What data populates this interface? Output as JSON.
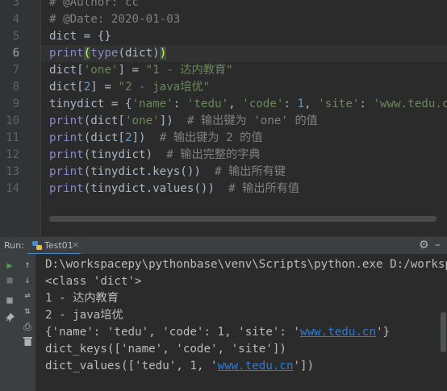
{
  "editor": {
    "line_numbers": [
      "3",
      "4",
      "5",
      "6",
      "7",
      "8",
      "9",
      "10",
      "11",
      "12",
      "13",
      "14"
    ],
    "lines": {
      "l3": "# @Author: cc",
      "l4": "# @Date: 2020-01-03",
      "l5a": "dict = {}",
      "l6_print": "print",
      "l6_open": "(",
      "l6_type": "type",
      "l6_mid": "(dict)",
      "l6_close": ")",
      "l7a": "dict[",
      "l7b": "'one'",
      "l7c": "] = ",
      "l7d": "\"1 - 达内教育\"",
      "l8a": "dict[",
      "l8b": "2",
      "l8c": "] = ",
      "l8d": "\"2 - java培优\"",
      "l9a": "tinydict = {",
      "l9b": "'name'",
      "l9c": ": ",
      "l9d": "'tedu'",
      "l9e": ", ",
      "l9f": "'code'",
      "l9g": ": ",
      "l9h": "1",
      "l9i": ", ",
      "l9j": "'site'",
      "l9k": ": ",
      "l9l": "'www.tedu.cn",
      "l10_print": "print",
      "l10a": "(dict[",
      "l10b": "'one'",
      "l10c": "])  ",
      "l10d": "# 输出键为 'one' 的值",
      "l11_print": "print",
      "l11a": "(dict[",
      "l11b": "2",
      "l11c": "])  ",
      "l11d": "# 输出键为 2 的值",
      "l12_print": "print",
      "l12a": "(tinydict)  ",
      "l12b": "# 输出完整的字典",
      "l13_print": "print",
      "l13a": "(tinydict.keys())  ",
      "l13b": "# 输出所有键",
      "l14_print": "print",
      "l14a": "(tinydict.values())  ",
      "l14b": "# 输出所有值"
    }
  },
  "run_panel": {
    "label": "Run:",
    "tab_label": "Test01",
    "close": "×",
    "gear_icon": "gear-icon",
    "gear_glyph": "⚙",
    "minimize_glyph": "–"
  },
  "console": {
    "line1": "D:\\workspacepy\\pythonbase\\venv\\Scripts\\python.exe D:/workspa",
    "line2": "<class 'dict'>",
    "line3": "1 - 达内教育",
    "line4": "2 - java培优",
    "line5a": "{'name': 'tedu', 'code': 1, 'site': '",
    "line5_link": "www.tedu.cn",
    "line5b": "'}",
    "line6": "dict_keys(['name', 'code', 'site'])",
    "line7a": "dict_values(['tedu', 1, '",
    "line7_link": "www.tedu.cn",
    "line7b": "'])"
  },
  "toolbar_icons": {
    "rerun": "▶",
    "stop": "■",
    "up": "↑",
    "down": "↓",
    "wrap": "⇌",
    "sort": "⇅",
    "layout": "▦",
    "print": "⎙",
    "pin": "📌",
    "trash": "🗑"
  },
  "colors": {
    "background": "#2b2b2b",
    "comment": "#808080",
    "string": "#6a8759",
    "number": "#6897bb",
    "builtin": "#8888c6",
    "link": "#287bde",
    "run_green": "#499c54"
  }
}
